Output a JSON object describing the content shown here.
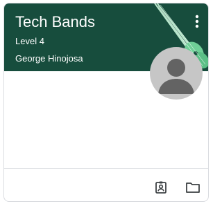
{
  "course": {
    "title": "Tech Bands",
    "section": "Level 4",
    "teacher": "George Hinojosa"
  },
  "theme": {
    "header_color": "#174d3d",
    "accent_color": "#6fcf97",
    "avatar_color": "#c6c6c6"
  },
  "icons": {
    "menu": "more-vert-icon",
    "avatar": "person-avatar-icon",
    "portfolio": "assignment-ind-icon",
    "folder": "folder-icon"
  }
}
